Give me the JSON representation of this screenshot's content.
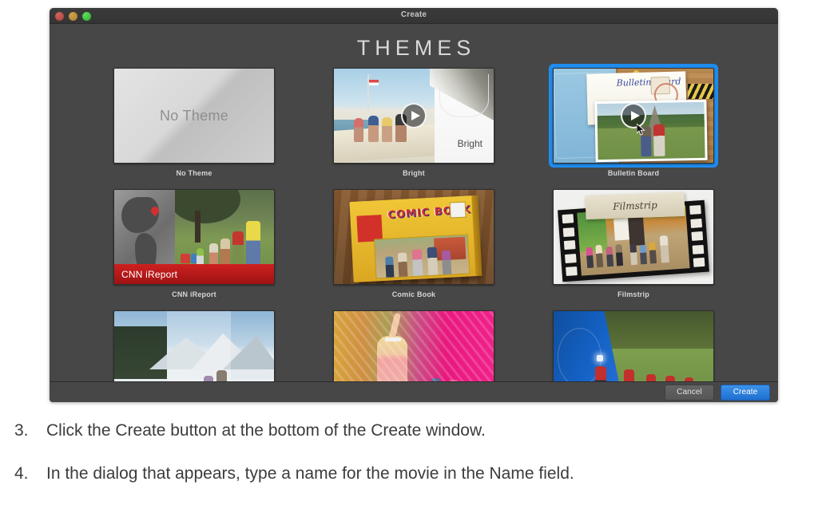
{
  "window": {
    "title": "Create",
    "heading": "THEMES",
    "traffic_lights": [
      {
        "name": "close",
        "color": "#c0504d"
      },
      {
        "name": "minimize",
        "color": "#c08f3e"
      },
      {
        "name": "zoom",
        "color": "#3cc93c"
      }
    ],
    "accent_selection_color": "#1f8ced"
  },
  "themes": [
    {
      "id": "no-theme",
      "label": "No Theme",
      "selected": false,
      "has_play": false,
      "thumb_text": "No Theme"
    },
    {
      "id": "bright",
      "label": "Bright",
      "selected": false,
      "has_play": true,
      "thumb_text": "Bright"
    },
    {
      "id": "bulletin-board",
      "label": "Bulletin Board",
      "selected": true,
      "has_play": true,
      "thumb_text": "Bulletin Board"
    },
    {
      "id": "cnn-ireport",
      "label": "CNN iReport",
      "selected": false,
      "has_play": false,
      "thumb_text": "CNN iReport"
    },
    {
      "id": "comic-book",
      "label": "Comic Book",
      "selected": false,
      "has_play": false,
      "thumb_text": "COMIC BOOK"
    },
    {
      "id": "filmstrip",
      "label": "Filmstrip",
      "selected": false,
      "has_play": false,
      "thumb_text": "Filmstrip"
    },
    {
      "id": "photo-album",
      "label": "",
      "selected": false,
      "has_play": false,
      "thumb_text": ""
    },
    {
      "id": "festive",
      "label": "",
      "selected": false,
      "has_play": false,
      "thumb_text": ""
    },
    {
      "id": "news",
      "label": "",
      "selected": false,
      "has_play": false,
      "thumb_text": ""
    }
  ],
  "buttons": {
    "cancel_label": "Cancel",
    "create_label": "Create"
  },
  "instructions": [
    {
      "number": "3.",
      "text": "Click the Create button at the bottom of the Create window."
    },
    {
      "number": "4.",
      "text": "In the dialog that appears, type a name for the movie in the Name field."
    }
  ]
}
